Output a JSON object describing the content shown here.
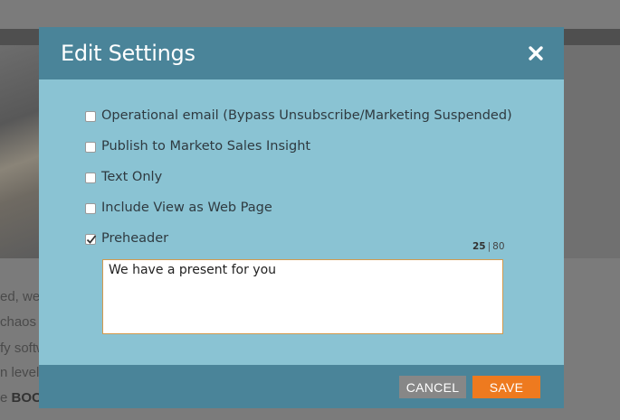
{
  "background": {
    "text_lines": [
      {
        "text": "ed, we"
      },
      {
        "text": "chaos"
      },
      {
        "text": "fy softw"
      },
      {
        "text": "n level"
      },
      {
        "text": "e ",
        "bold": "BOO"
      }
    ]
  },
  "dialog": {
    "title": "Edit Settings",
    "close_icon": "close-icon",
    "options": [
      {
        "label": "Operational email (Bypass Unsubscribe/Marketing Suspended)",
        "checked": false
      },
      {
        "label": "Publish to Marketo Sales Insight",
        "checked": false
      },
      {
        "label": "Text Only",
        "checked": false
      },
      {
        "label": "Include View as Web Page",
        "checked": false
      },
      {
        "label": "Preheader",
        "checked": true
      }
    ],
    "preheader": {
      "value": "We have a present for you",
      "char_count": "25",
      "separator": "|",
      "char_max": "80"
    },
    "buttons": {
      "cancel_label": "CANCEL",
      "save_label": "SAVE"
    }
  },
  "colors": {
    "header": "#4a8499",
    "body": "#8ac3d3",
    "save": "#ee7a1f",
    "cancel": "#878787"
  }
}
